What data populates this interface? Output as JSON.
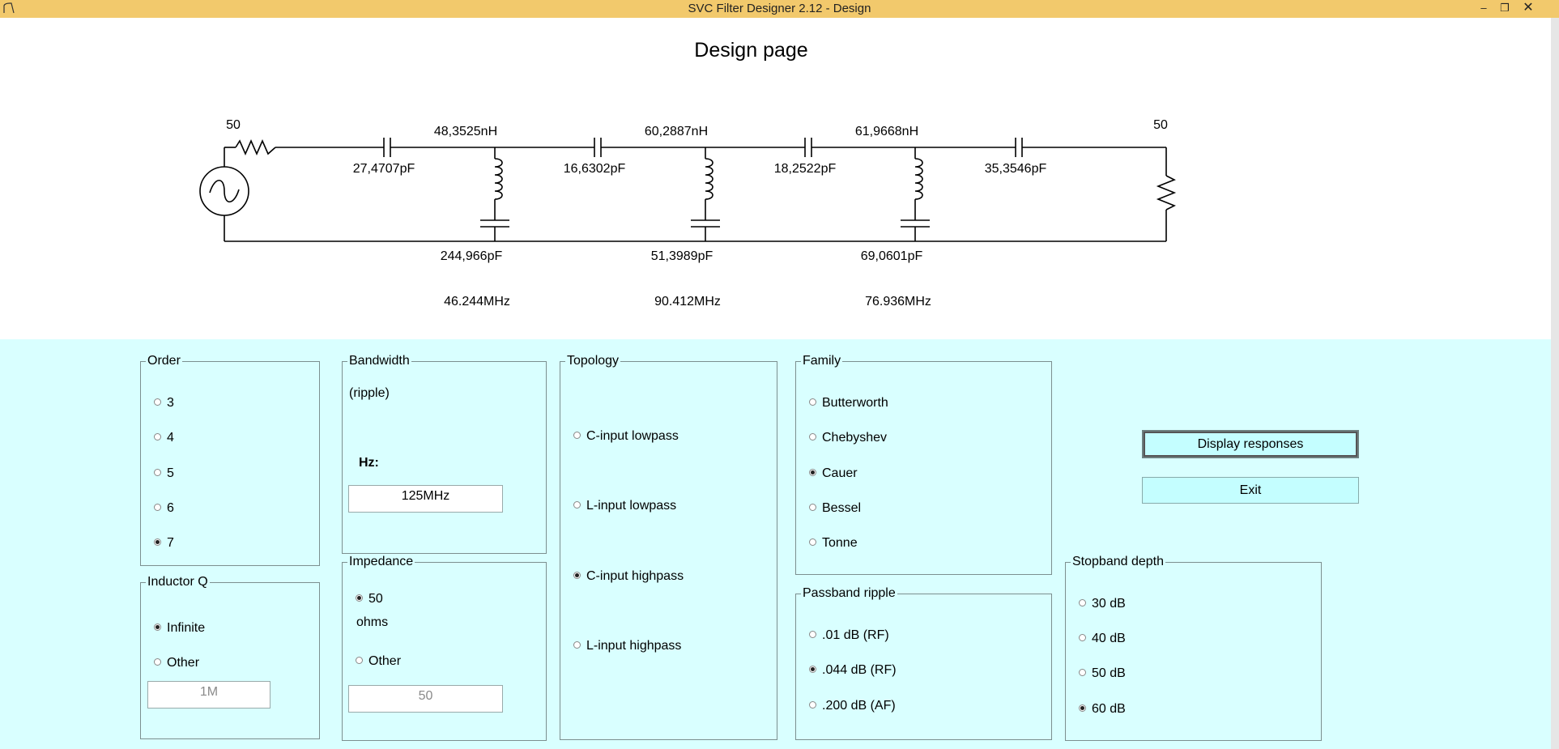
{
  "window": {
    "title": "SVC Filter Designer 2.12 - Design",
    "minimize_icon": "minimize-icon",
    "restore_icon": "restore-icon",
    "close_icon": "close-icon"
  },
  "design": {
    "title": "Design page",
    "schematic": {
      "source_impedance": "50",
      "load_impedance": "50",
      "series_caps": [
        "27,4707pF",
        "16,6302pF",
        "18,2522pF",
        "35,3546pF"
      ],
      "shunt_inductors": [
        "48,3525nH",
        "60,2887nH",
        "61,9668nH"
      ],
      "shunt_caps": [
        "244,966pF",
        "51,3989pF",
        "69,0601pF"
      ],
      "notch_freqs": [
        "46.244MHz",
        "90.412MHz",
        "76.936MHz"
      ]
    }
  },
  "order": {
    "legend": "Order",
    "options": [
      "3",
      "4",
      "5",
      "6",
      "7"
    ],
    "selected": "7"
  },
  "bandwidth": {
    "legend": "Bandwidth",
    "subtitle": "(ripple)",
    "unit_label": "Hz:",
    "value": "125MHz"
  },
  "topology": {
    "legend": "Topology",
    "options": [
      "C-input lowpass",
      "L-input lowpass",
      "C-input highpass",
      "L-input highpass"
    ],
    "selected": "C-input highpass"
  },
  "family": {
    "legend": "Family",
    "options": [
      "Butterworth",
      "Chebyshev",
      "Cauer",
      "Bessel",
      "Tonne"
    ],
    "selected": "Cauer"
  },
  "inductor_q": {
    "legend": "Inductor Q",
    "options": [
      "Infinite",
      "Other"
    ],
    "selected": "Infinite",
    "value": "1M"
  },
  "impedance": {
    "legend": "Impedance",
    "option_50": "50",
    "ohms_label": "ohms",
    "option_other": "Other",
    "selected": "50",
    "value": "50"
  },
  "passband_ripple": {
    "legend": "Passband ripple",
    "options": [
      ".01 dB (RF)",
      ".044 dB (RF)",
      ".200 dB (AF)"
    ],
    "selected": ".044 dB (RF)"
  },
  "stopband_depth": {
    "legend": "Stopband depth",
    "options": [
      "30 dB",
      "40 dB",
      "50 dB",
      "60 dB"
    ],
    "selected": "60 dB"
  },
  "buttons": {
    "display_responses": "Display responses",
    "exit": "Exit"
  }
}
